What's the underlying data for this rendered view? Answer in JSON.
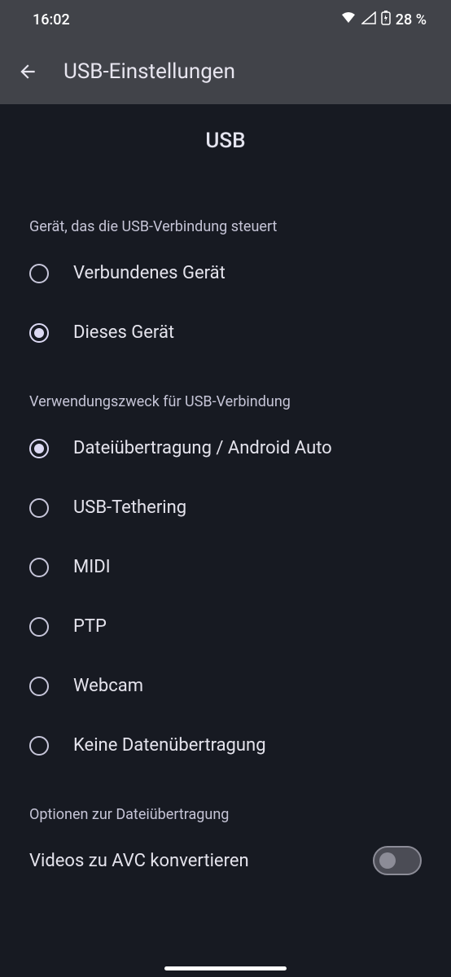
{
  "status_bar": {
    "time": "16:02",
    "battery_text": "28 %"
  },
  "app_bar": {
    "title": "USB-Einstellungen"
  },
  "heading": "USB",
  "section_control": {
    "header": "Gerät, das die USB-Verbindung steuert",
    "options": [
      {
        "label": "Verbundenes Gerät",
        "selected": false
      },
      {
        "label": "Dieses Gerät",
        "selected": true
      }
    ]
  },
  "section_usage": {
    "header": "Verwendungszweck für USB-Verbindung",
    "options": [
      {
        "label": "Dateiübertragung / Android Auto",
        "selected": true
      },
      {
        "label": "USB-Tethering",
        "selected": false
      },
      {
        "label": "MIDI",
        "selected": false
      },
      {
        "label": "PTP",
        "selected": false
      },
      {
        "label": "Webcam",
        "selected": false
      },
      {
        "label": "Keine Datenübertragung",
        "selected": false
      }
    ]
  },
  "section_file_options": {
    "header": "Optionen zur Dateiübertragung",
    "switch": {
      "label": "Videos zu AVC konvertieren",
      "on": false
    }
  }
}
